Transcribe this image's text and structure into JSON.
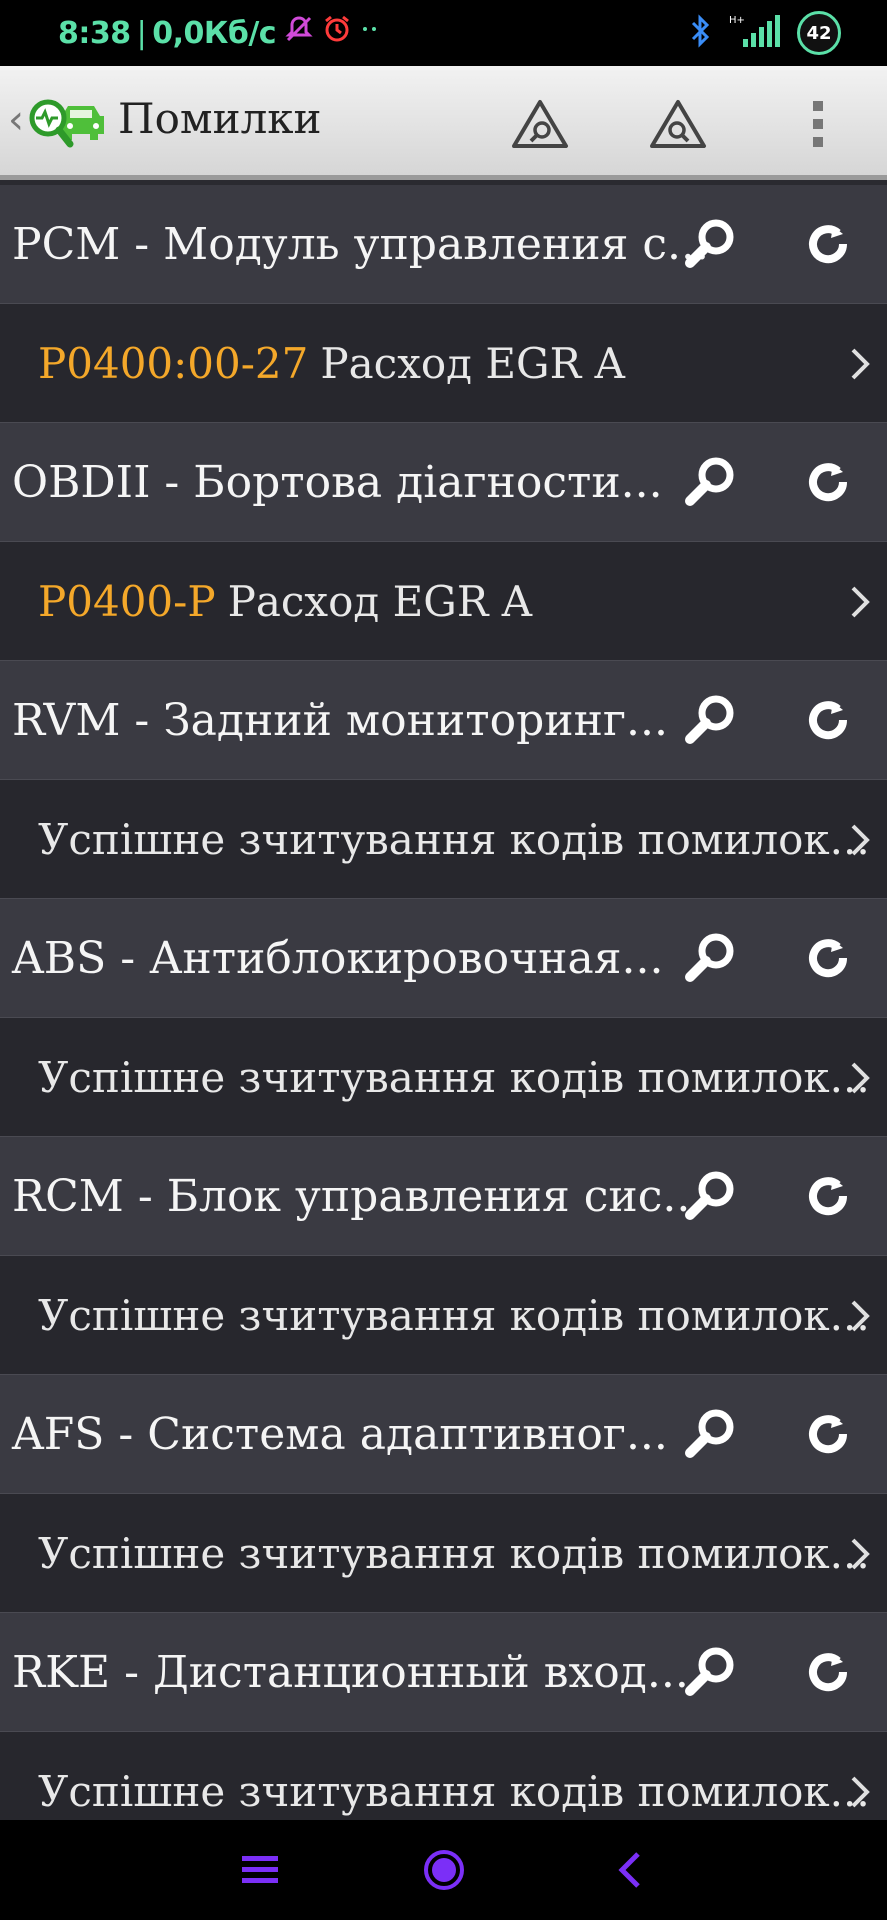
{
  "status_bar": {
    "time": "8:38",
    "separator": "|",
    "speed": "0,0Кб/с",
    "battery": "42",
    "network": "H+",
    "accent_color": "#5be0a8"
  },
  "toolbar": {
    "title": "Помилки",
    "icons": [
      "car-diagnostic-logo",
      "scan-triangle-icon",
      "scan-triangle-icon",
      "more-vert-icon"
    ]
  },
  "rows": [
    {
      "type": "module",
      "title": "PCM - Модуль управления с..."
    },
    {
      "type": "detail",
      "code": "P0400:00-27",
      "text": "Расход EGR A"
    },
    {
      "type": "module",
      "title": "OBDII - Бортова діагности..."
    },
    {
      "type": "detail",
      "code": "P0400-P",
      "text": "Расход EGR A"
    },
    {
      "type": "module",
      "title": "RVM - Задний мониторинг..."
    },
    {
      "type": "detail",
      "code": "",
      "text": "Успішне зчитування кодів помилок..."
    },
    {
      "type": "module",
      "title": "ABS - Антиблокировочная..."
    },
    {
      "type": "detail",
      "code": "",
      "text": "Успішне зчитування кодів помилок..."
    },
    {
      "type": "module",
      "title": "RCM - Блок управления сис..."
    },
    {
      "type": "detail",
      "code": "",
      "text": "Успішне зчитування кодів помилок..."
    },
    {
      "type": "module",
      "title": "AFS - Система адаптивног..."
    },
    {
      "type": "detail",
      "code": "",
      "text": "Успішне зчитування кодів помилок..."
    },
    {
      "type": "module",
      "title": "RKE - Дистанционный вход..."
    },
    {
      "type": "detail",
      "code": "",
      "text": "Успішне зчитування кодів помилок..."
    }
  ],
  "colors": {
    "code": "#f4a82a",
    "module_bg": "#3a3a42",
    "detail_bg": "#27272d",
    "nav": "#7b2ff7"
  },
  "nav_icons": [
    "menu-icon",
    "home-icon",
    "back-icon"
  ]
}
